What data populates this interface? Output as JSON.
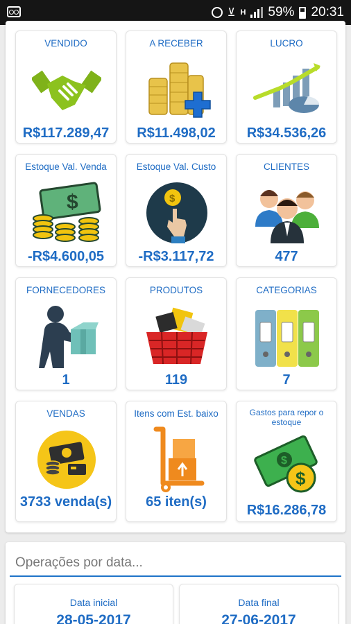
{
  "status_bar": {
    "battery": "59%",
    "time": "20:31",
    "network": "H",
    "icons": [
      "voicemail-icon",
      "alarm-icon",
      "wifi-icon",
      "signal-icon",
      "battery-icon"
    ]
  },
  "tiles": [
    {
      "label": "VENDIDO",
      "value": "R$117.289,47",
      "icon": "handshake-icon"
    },
    {
      "label": "A RECEBER",
      "value": "R$11.498,02",
      "icon": "coins-plus-icon"
    },
    {
      "label": "LUCRO",
      "value": "R$34.536,26",
      "icon": "growth-chart-icon"
    },
    {
      "label": "Estoque Val. Venda",
      "value": "-R$4.600,05",
      "icon": "money-coins-icon"
    },
    {
      "label": "Estoque Val. Custo",
      "value": "-R$3.117,72",
      "icon": "coin-hand-icon"
    },
    {
      "label": "CLIENTES",
      "value": "477",
      "icon": "people-icon"
    },
    {
      "label": "FORNECEDORES",
      "value": "1",
      "icon": "delivery-person-icon"
    },
    {
      "label": "PRODUTOS",
      "value": "119",
      "icon": "shopping-basket-icon"
    },
    {
      "label": "CATEGORIAS",
      "value": "7",
      "icon": "folders-icon"
    },
    {
      "label": "VENDAS",
      "value": "3733 venda(s)",
      "icon": "sales-money-icon"
    },
    {
      "label": "Itens com Est. baixo",
      "value": "65 iten(s)",
      "icon": "hand-truck-icon"
    },
    {
      "label": "Gastos para repor o estoque",
      "value": "R$16.286,78",
      "icon": "banknote-coin-icon"
    }
  ],
  "operations": {
    "search_placeholder": "Operações por data...",
    "start_label": "Data inicial",
    "start_value": "28-05-2017",
    "end_label": "Data final",
    "end_value": "27-06-2017"
  },
  "colors": {
    "accent": "#1f6cc4",
    "statusbar": "#151515",
    "background": "#ececec"
  }
}
